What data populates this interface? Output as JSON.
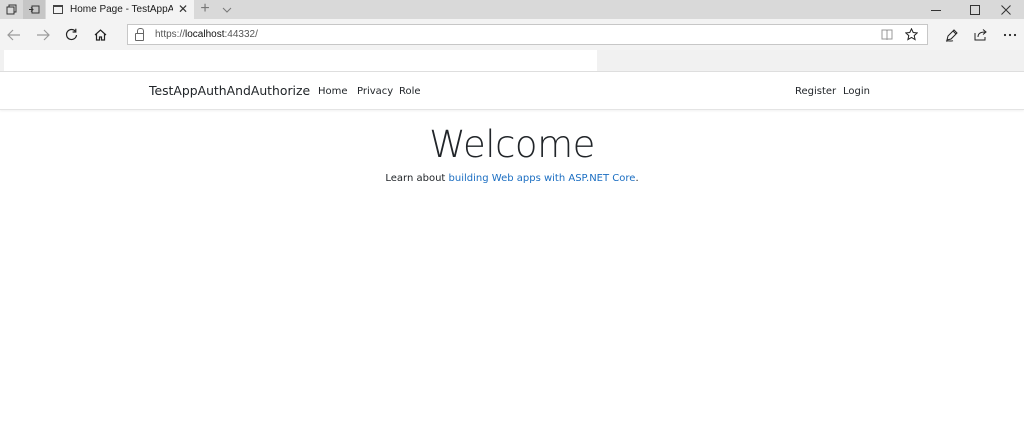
{
  "browser": {
    "tab_title": "Home Page - TestAppAuthAndAuthorize",
    "tab_close_glyph": "✕",
    "new_tab_glyph": "+",
    "url_scheme": "https://",
    "url_host": "localhost",
    "url_rest": ":44332/",
    "icons": {
      "back": "back-arrow-icon",
      "forward": "forward-arrow-icon",
      "refresh": "refresh-icon",
      "home": "home-icon",
      "lock": "lock-icon",
      "reading": "reading-view-icon",
      "favorite": "star-icon",
      "notes": "pen-icon",
      "share": "share-icon",
      "more": "more-icon"
    }
  },
  "site": {
    "brand": "TestAppAuthAndAuthorize",
    "nav": [
      "Home",
      "Privacy",
      "Role"
    ],
    "nav_right": [
      "Register",
      "Login"
    ]
  },
  "main": {
    "heading": "Welcome",
    "learn_prefix": "Learn about ",
    "learn_link": "building Web apps with ASP.NET Core",
    "learn_suffix": "."
  },
  "colors": {
    "link": "#1b6ec2",
    "text": "#212529",
    "tabstrip": "#d9d9d9"
  }
}
